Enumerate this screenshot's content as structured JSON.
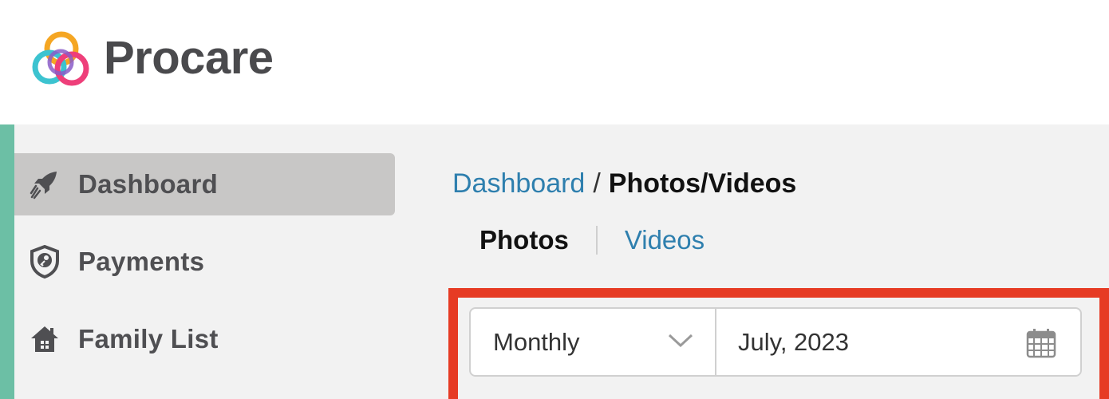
{
  "brand": {
    "name": "Procare"
  },
  "sidebar": {
    "items": [
      {
        "label": "Dashboard",
        "icon": "rocket-icon",
        "active": true
      },
      {
        "label": "Payments",
        "icon": "shield-key-icon",
        "active": false
      },
      {
        "label": "Family List",
        "icon": "house-icon",
        "active": false
      }
    ]
  },
  "breadcrumb": {
    "parent": "Dashboard",
    "separator": "/",
    "current": "Photos/Videos"
  },
  "tabs": {
    "photos": "Photos",
    "videos": "Videos"
  },
  "filters": {
    "period": "Monthly",
    "date": "July, 2023"
  },
  "colors": {
    "accent_bar": "#6cbfa5",
    "link": "#2e7fae",
    "highlight": "#e63b24",
    "active_nav_bg": "#c8c7c6"
  }
}
